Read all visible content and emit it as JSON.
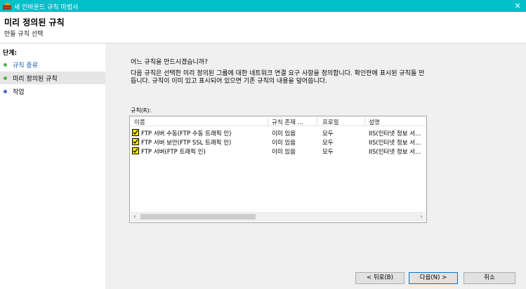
{
  "window": {
    "title": "새 인바운드 규칙 마법사",
    "close_glyph": "✕"
  },
  "header": {
    "title": "미리 정의된 규칙",
    "subtitle": "만들 규칙 선택"
  },
  "sidebar": {
    "steps_label": "단계:",
    "steps": [
      {
        "label": "규칙 종류",
        "state": "done"
      },
      {
        "label": "미리 정의된 규칙",
        "state": "current"
      },
      {
        "label": "작업",
        "state": "pending"
      }
    ]
  },
  "main": {
    "question": "어느 규칙을 만드시겠습니까?",
    "description": "다음 규칙은 선택한 미리 정의된 그룹에 대한 네트워크 연결 요구 사항을 정의합니다. 확인란에 표시된 규칙들 만듭니다. 규칙이 이미 있고 표시되어 있으면 기존 규칙의 내용을 덮어씁니다.",
    "rules_label": "규칙(R):",
    "columns": [
      "이름",
      "규칙 존재 ...",
      "프로필",
      "설명"
    ],
    "rows": [
      {
        "name": "FTP 서버 수동(FTP 수동 트래픽 인)",
        "exists": "이미 있음",
        "profile": "모두",
        "description": "IIS(인터넷 정보 서...",
        "checked": true
      },
      {
        "name": "FTP 서버 보안(FTP SSL 트래픽 인)",
        "exists": "이미 있음",
        "profile": "모두",
        "description": "IIS(인터넷 정보 서...",
        "checked": true
      },
      {
        "name": "FTP 서버(FTP 트래픽 인)",
        "exists": "이미 있음",
        "profile": "모두",
        "description": "IIS(인터넷 정보 서...",
        "checked": true
      }
    ],
    "scroll_left": "‹",
    "scroll_right": "›"
  },
  "buttons": {
    "back": "< 뒤로(B)",
    "next": "다음(N) >",
    "cancel": "취소"
  },
  "colors": {
    "titlebar": "#00c0c8",
    "checkbox_highlight": "#ffee00",
    "step_done": "#52b052",
    "step_pending": "#4a66c8"
  }
}
